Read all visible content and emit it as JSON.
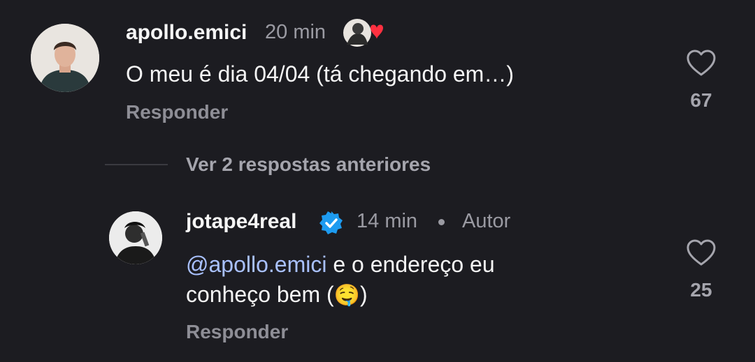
{
  "comment1": {
    "username": "apollo.emici",
    "time": "20 min",
    "text": "O meu é dia 04/04 (tá chegando em…)",
    "reply_label": "Responder",
    "likes": "67",
    "avatar_icon": "user-avatar",
    "liked_by_author_icon": "author-avatar-with-heart"
  },
  "view_more": {
    "label": "Ver 2 respostas anteriores"
  },
  "comment2": {
    "username": "jotape4real",
    "verified_icon": "verified-badge",
    "time": "14 min",
    "separator": "•",
    "author_badge": "Autor",
    "mention": "@apollo.emici",
    "text_line1": " e o endereço eu",
    "text_line2": "conheço bem (",
    "emoji": "🤤",
    "text_close": ")",
    "reply_label": "Responder",
    "likes": "25"
  },
  "colors": {
    "background": "#1c1c21",
    "mention": "#a9c1ff",
    "verified": "#1d9bf0",
    "heart": "#ff3040"
  }
}
